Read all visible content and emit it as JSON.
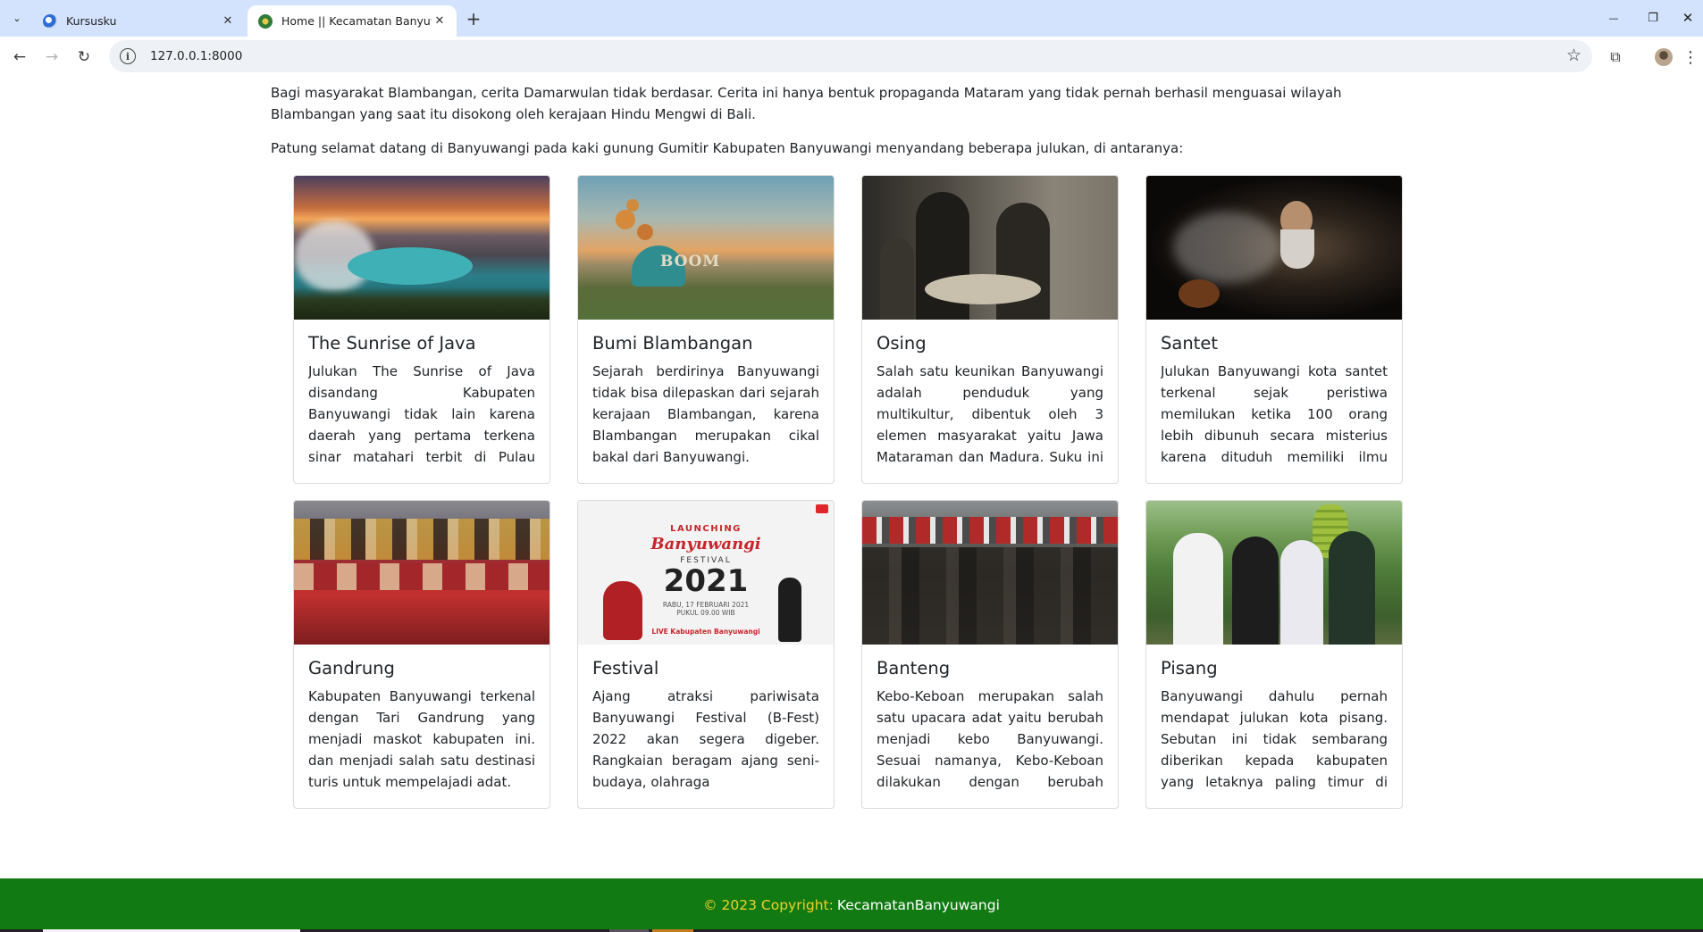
{
  "browser": {
    "tabs": [
      {
        "title": "Kursusku",
        "active": false
      },
      {
        "title": "Home || Kecamatan Banyuwangi",
        "active": true
      }
    ],
    "url": "127.0.0.1:8000",
    "icons": {
      "tab_search": "chevron-down-icon",
      "close": "close-icon",
      "new_tab": "plus-icon",
      "minimize": "minimize-icon",
      "restore": "restore-icon",
      "window_close": "close-icon",
      "back": "arrow-left-icon",
      "forward": "arrow-right-icon",
      "reload": "reload-icon",
      "info": "info-icon",
      "bookmark": "star-icon",
      "extensions": "puzzle-icon",
      "menu": "kebab-icon"
    },
    "glyphs": {
      "tab_search": "⌄",
      "close": "✕",
      "new_tab": "+",
      "minimize": "—",
      "restore": "❐",
      "window_close": "✕",
      "back": "←",
      "forward": "→",
      "reload": "↻",
      "info": "i",
      "bookmark": "☆",
      "extensions": "⧉",
      "menu": "⋮"
    }
  },
  "content": {
    "intro_paragraph": "Bagi masyarakat Blambangan, cerita Damarwulan tidak berdasar. Cerita ini hanya bentuk propaganda Mataram yang tidak pernah berhasil menguasai wilayah Blambangan yang saat itu disokong oleh kerajaan Hindu Mengwi di Bali.",
    "lead_paragraph": "Patung selamat datang di Banyuwangi pada kaki gunung Gumitir Kabupaten Banyuwangi menyandang beberapa julukan, di antaranya:",
    "cards": [
      {
        "title": "The Sunrise of Java",
        "text": "Julukan The Sunrise of Java disandang Kabupaten Banyuwangi tidak lain karena daerah yang pertama terkena sinar matahari terbit di Pulau Jawa."
      },
      {
        "title": "Bumi Blambangan",
        "text": "Sejarah berdirinya Banyuwangi tidak bisa dilepaskan dari sejarah kerajaan Blambangan, karena Blambangan merupakan cikal bakal dari Banyuwangi."
      },
      {
        "title": "Osing",
        "text": "Salah satu keunikan Banyuwangi adalah penduduk yang multikultur, dibentuk oleh 3 elemen masyarakat yaitu Jawa Mataraman dan Madura. Suku ini ada di jaman penjajahan"
      },
      {
        "title": "Santet",
        "text": "Julukan Banyuwangi kota santet terkenal sejak peristiwa memilukan ketika 100 orang lebih dibunuh secara misterius karena dituduh memiliki ilmu santet."
      },
      {
        "title": "Gandrung",
        "text": "Kabupaten Banyuwangi terkenal dengan Tari Gandrung yang menjadi maskot kabupaten ini. dan menjadi salah satu destinasi turis untuk mempelajadi adat."
      },
      {
        "title": "Festival",
        "text": "Ajang atraksi pariwisata Banyuwangi Festival (B-Fest) 2022 akan segera digeber. Rangkaian beragam ajang seni-budaya, olahraga"
      },
      {
        "title": "Banteng",
        "text": "Kebo-Keboan merupakan salah satu upacara adat yaitu berubah menjadi kebo Banyuwangi. Sesuai namanya, Kebo-Keboan dilakukan dengan berubah menjadi kerbau."
      },
      {
        "title": "Pisang",
        "text": "Banyuwangi dahulu pernah mendapat julukan kota pisang. Sebutan ini tidak sembarang diberikan kepada kabupaten yang letaknya paling timur di Pulau Jawa"
      }
    ],
    "festival_poster": {
      "heading": "LAUNCHING",
      "script": "Banyuwangi",
      "subtitle": "FESTIVAL",
      "year": "2021",
      "date": "RABU, 17 FEBRUARI 2021",
      "time": "PUKUL 09.00 WIB",
      "live": "LIVE Kabupaten Banyuwangi",
      "mark": "BOOM"
    }
  },
  "footer": {
    "copyright": "© 2023 Copyright:",
    "brand": "KecamatanBanyuwangi"
  },
  "colors": {
    "tabbar": "#d3e3fd",
    "footer_bg": "#127a12",
    "footer_copy": "#f0d02c",
    "footer_brand": "#ffffff"
  }
}
